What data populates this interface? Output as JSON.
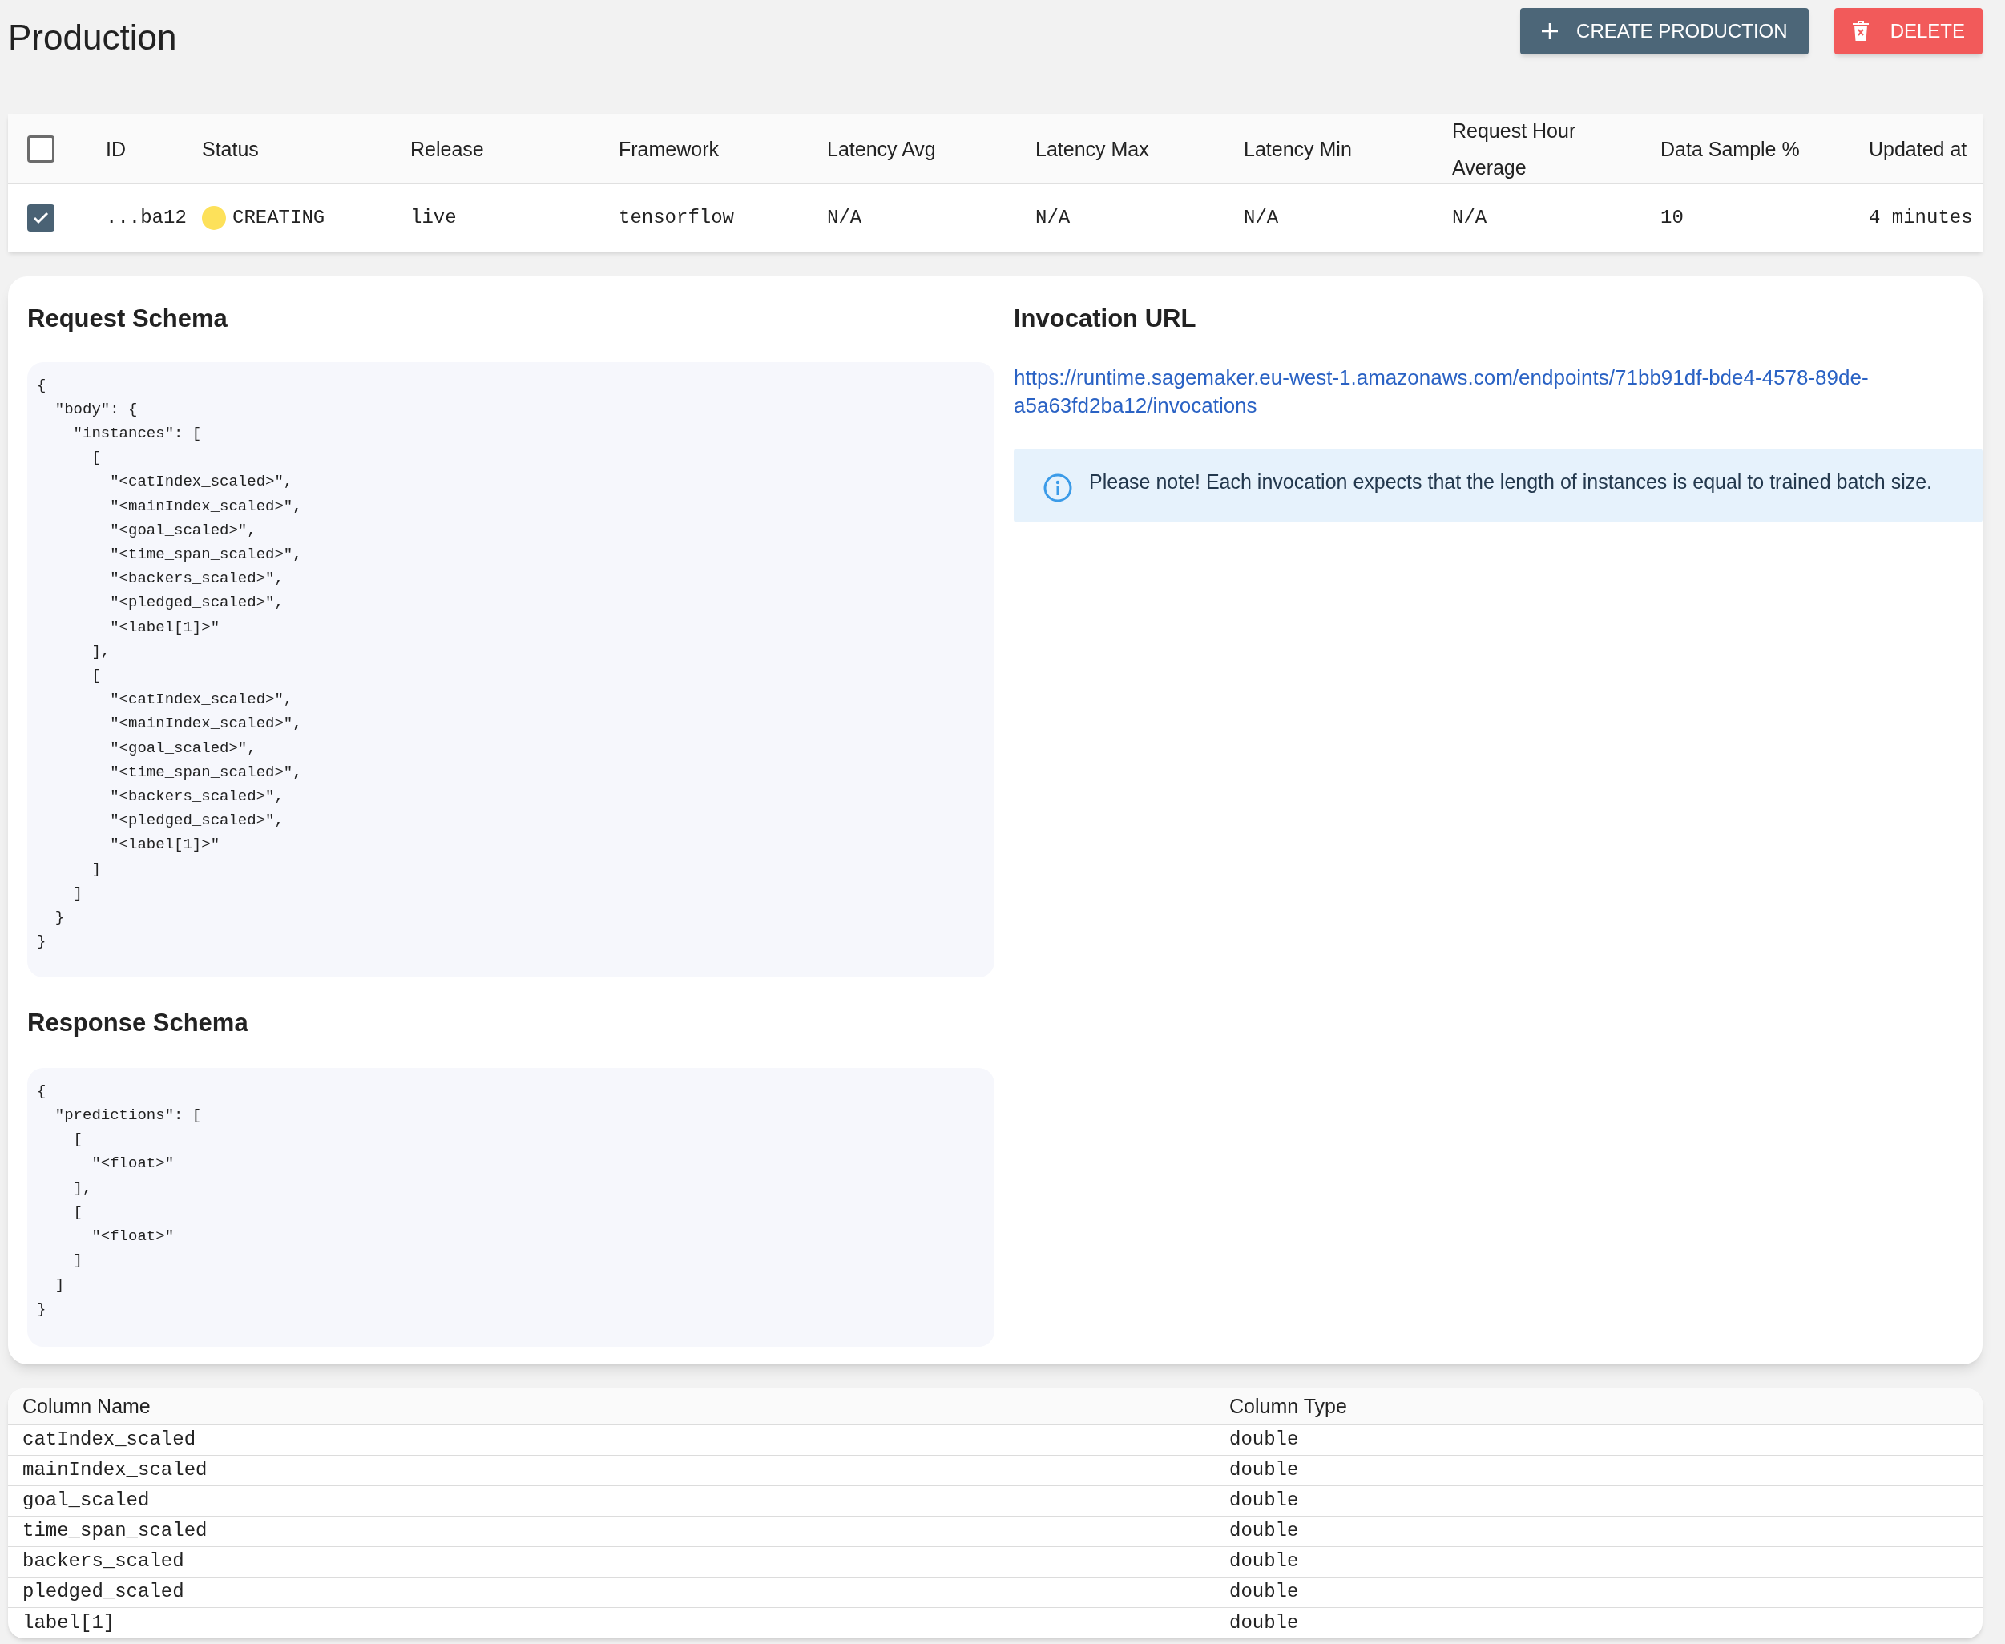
{
  "page_title": "Production",
  "actions": [
    {
      "kind": "create",
      "label": "CREATE PRODUCTION"
    },
    {
      "kind": "delete",
      "label": "DELETE"
    }
  ],
  "endpoints_table": {
    "all_checked": false,
    "columns": [
      "ID",
      "Status",
      "Release",
      "Framework",
      "Latency Avg",
      "Latency Max",
      "Latency Min",
      "Request Hour Average",
      "Data Sample %",
      "Updated at"
    ],
    "rows": [
      {
        "checked": true,
        "cells": [
          {
            "kind": "text",
            "text": "...ba12"
          },
          {
            "kind": "status",
            "text": "CREATING",
            "color": "#fde15a"
          },
          {
            "kind": "text",
            "text": "live"
          },
          {
            "kind": "text",
            "text": "tensorflow"
          },
          {
            "kind": "text",
            "text": "N/A"
          },
          {
            "kind": "text",
            "text": "N/A"
          },
          {
            "kind": "text",
            "text": "N/A"
          },
          {
            "kind": "text",
            "text": "N/A"
          },
          {
            "kind": "text",
            "text": "10"
          },
          {
            "kind": "text",
            "text": "4 minutes"
          }
        ]
      }
    ]
  },
  "request_schema": {
    "title": "Request Schema",
    "code": "{\n  \"body\": {\n    \"instances\": [\n      [\n        \"<catIndex_scaled>\",\n        \"<mainIndex_scaled>\",\n        \"<goal_scaled>\",\n        \"<time_span_scaled>\",\n        \"<backers_scaled>\",\n        \"<pledged_scaled>\",\n        \"<label[1]>\"\n      ],\n      [\n        \"<catIndex_scaled>\",\n        \"<mainIndex_scaled>\",\n        \"<goal_scaled>\",\n        \"<time_span_scaled>\",\n        \"<backers_scaled>\",\n        \"<pledged_scaled>\",\n        \"<label[1]>\"\n      ]\n    ]\n  }\n}"
  },
  "response_schema": {
    "title": "Response Schema",
    "code": "{\n  \"predictions\": [\n    [\n      \"<float>\"\n    ],\n    [\n      \"<float>\"\n    ]\n  ]\n}"
  },
  "invocation": {
    "title": "Invocation URL",
    "url_lines": [
      "https://runtime.sagemaker.eu-west-1.amazonaws.com/endpoints/71bb91df-bde4-4578-89de-",
      "a5a63fd2ba12/invocations"
    ],
    "note": "Please note! Each invocation expects that the length of instances is equal to trained batch size."
  },
  "columns_table": {
    "columns": [
      "Column Name",
      "Column Type"
    ],
    "rows": [
      [
        "catIndex_scaled",
        "double"
      ],
      [
        "mainIndex_scaled",
        "double"
      ],
      [
        "goal_scaled",
        "double"
      ],
      [
        "time_span_scaled",
        "double"
      ],
      [
        "backers_scaled",
        "double"
      ],
      [
        "pledged_scaled",
        "double"
      ],
      [
        "label[1]",
        "double"
      ]
    ]
  }
}
